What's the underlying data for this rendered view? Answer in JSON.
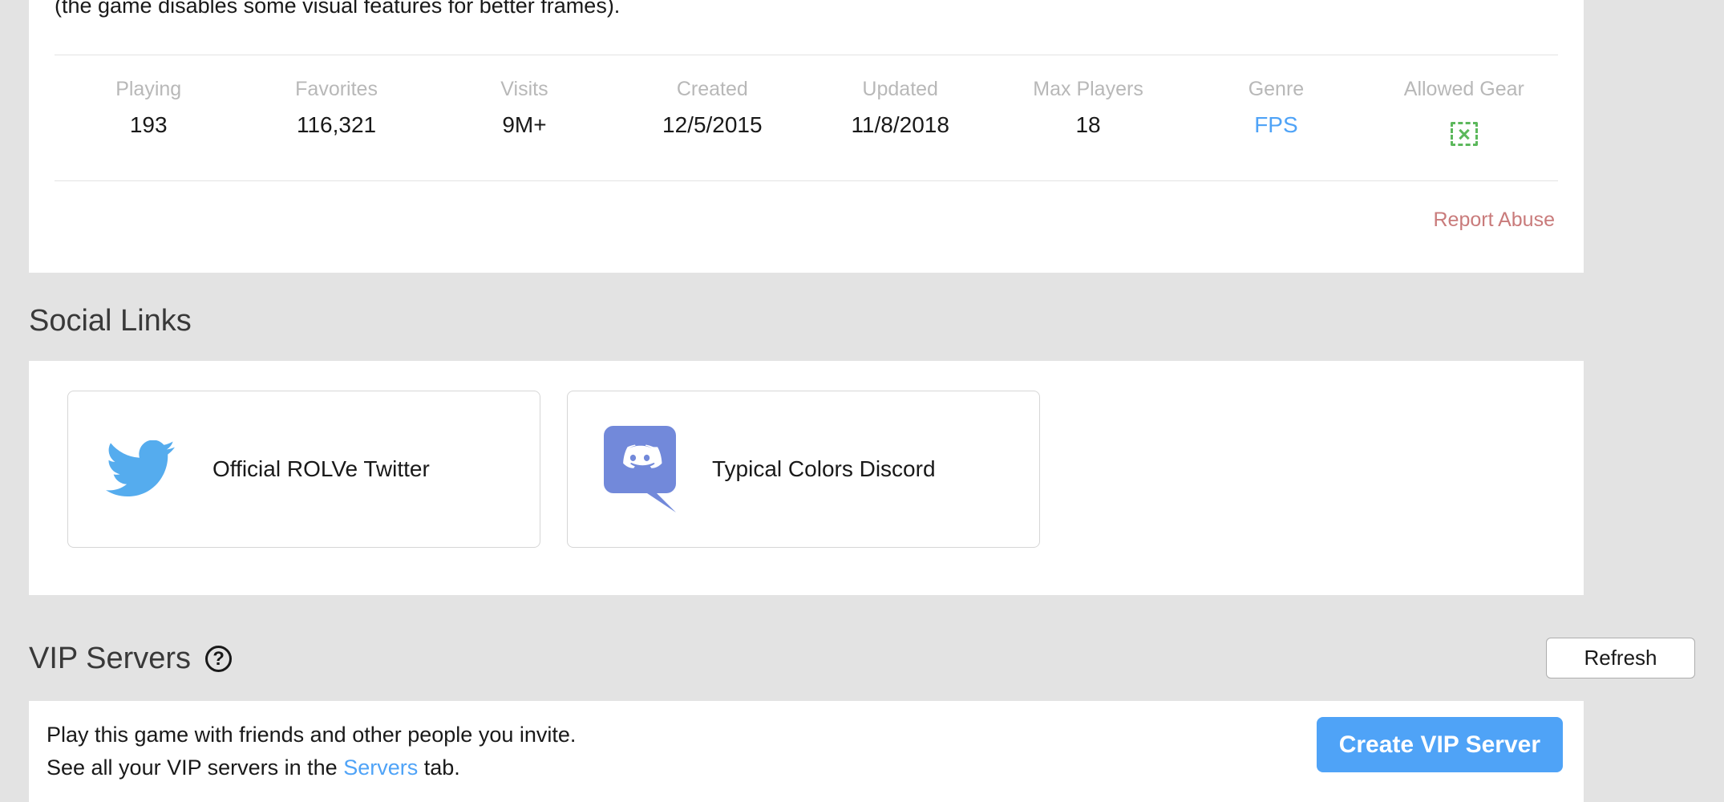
{
  "about": {
    "description_line": "(the game disables some visual features for better frames)."
  },
  "stats": {
    "items": [
      {
        "label": "Playing",
        "value": "193",
        "type": "text"
      },
      {
        "label": "Favorites",
        "value": "116,321",
        "type": "text"
      },
      {
        "label": "Visits",
        "value": "9M+",
        "type": "text"
      },
      {
        "label": "Created",
        "value": "12/5/2015",
        "type": "text"
      },
      {
        "label": "Updated",
        "value": "11/8/2018",
        "type": "text"
      },
      {
        "label": "Max Players",
        "value": "18",
        "type": "text"
      },
      {
        "label": "Genre",
        "value": "FPS",
        "type": "link"
      },
      {
        "label": "Allowed Gear",
        "value": "",
        "type": "icon",
        "icon": "gear-disallowed-icon"
      }
    ]
  },
  "report_abuse": {
    "label": "Report Abuse",
    "color": "#c97b7b"
  },
  "social_links": {
    "heading": "Social Links",
    "tiles": [
      {
        "label": "Official ROLVe Twitter",
        "icon": "twitter-icon",
        "color": "#55acee"
      },
      {
        "label": "Typical Colors Discord",
        "icon": "discord-icon",
        "color": "#7289da"
      }
    ]
  },
  "vip_servers": {
    "heading": "VIP Servers",
    "help_icon_glyph": "?",
    "refresh_label": "Refresh",
    "line1": "Play this game with friends and other people you invite.",
    "line2_prefix": "See all your VIP servers in the ",
    "line2_link": "Servers",
    "line2_suffix": " tab.",
    "create_button_label": "Create VIP Server"
  },
  "colors": {
    "accent_blue": "#4fa3f7",
    "page_background": "#e3e3e3",
    "card_background": "#ffffff",
    "muted_label": "#b8b8b8",
    "allowed_gear_green": "#5cb85c"
  }
}
